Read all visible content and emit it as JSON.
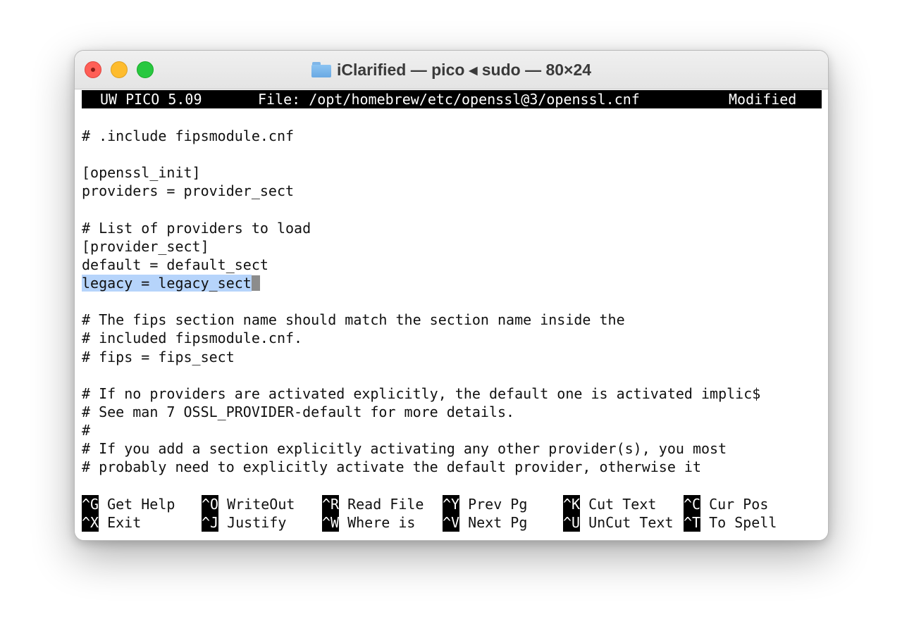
{
  "window": {
    "title": "iClarified — pico ◂ sudo — 80×24"
  },
  "icons": {
    "folder": "folder-icon"
  },
  "colors": {
    "close": "#ff5f57",
    "minimize": "#febc2e",
    "zoom": "#28c840",
    "selection": "#b6d4fb"
  },
  "editor": {
    "app_name": "UW PICO 5.09",
    "file_label": "File: /opt/homebrew/etc/openssl@3/openssl.cnf",
    "status": "Modified",
    "lines": [
      "# .include fipsmodule.cnf",
      "",
      "[openssl_init]",
      "providers = provider_sect",
      "",
      "# List of providers to load",
      "[provider_sect]",
      "default = default_sect",
      "legacy = legacy_sect",
      "",
      "# The fips section name should match the section name inside the",
      "# included fipsmodule.cnf.",
      "# fips = fips_sect",
      "",
      "# If no providers are activated explicitly, the default one is activated implic$",
      "# See man 7 OSSL_PROVIDER-default for more details.",
      "#",
      "# If you add a section explicitly activating any other provider(s), you most",
      "# probably need to explicitly activate the default provider, otherwise it"
    ],
    "selected_line": "legacy = legacy_sect"
  },
  "shortcuts": {
    "row1": [
      {
        "key": "^G",
        "label": "Get Help"
      },
      {
        "key": "^O",
        "label": "WriteOut"
      },
      {
        "key": "^R",
        "label": "Read File"
      },
      {
        "key": "^Y",
        "label": "Prev Pg"
      },
      {
        "key": "^K",
        "label": "Cut Text"
      },
      {
        "key": "^C",
        "label": "Cur Pos"
      }
    ],
    "row2": [
      {
        "key": "^X",
        "label": "Exit"
      },
      {
        "key": "^J",
        "label": "Justify"
      },
      {
        "key": "^W",
        "label": "Where is"
      },
      {
        "key": "^V",
        "label": "Next Pg"
      },
      {
        "key": "^U",
        "label": "UnCut Text"
      },
      {
        "key": "^T",
        "label": "To Spell"
      }
    ]
  }
}
